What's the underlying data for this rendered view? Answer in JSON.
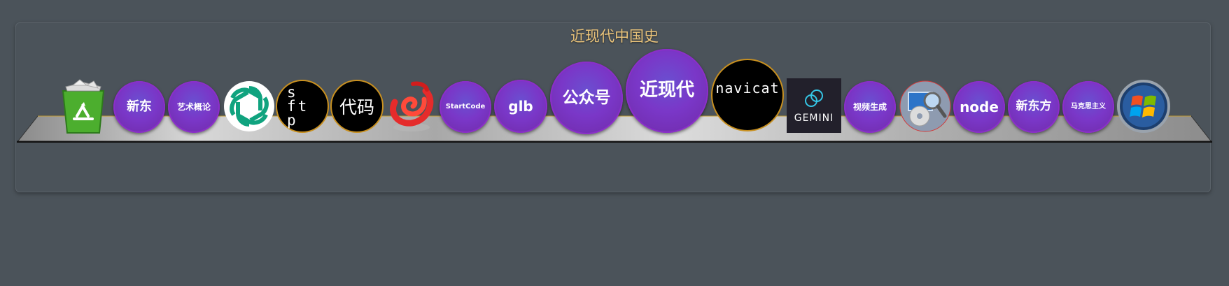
{
  "dock": {
    "title": "近现代中国史"
  },
  "items": {
    "recycle_bin": {
      "icon": "recycle-bin-icon"
    },
    "xindong": {
      "label": "新东"
    },
    "yishu": {
      "label": "艺术概论"
    },
    "chatgpt": {
      "icon": "chatgpt-logo-icon"
    },
    "sftp": {
      "chars": [
        "s",
        "ft",
        "p"
      ]
    },
    "daima": {
      "label": "代码"
    },
    "swirl": {
      "icon": "red-swirl-app-icon"
    },
    "startcode": {
      "label": "StartCode"
    },
    "glb": {
      "label": "glb"
    },
    "gongzhonghao": {
      "label": "公众号"
    },
    "jinxiandai": {
      "label": "近现代"
    },
    "navicat": {
      "label": "navicat"
    },
    "gemini": {
      "label": "GEMINI",
      "icon": "gemini-logo-icon"
    },
    "shipin": {
      "label": "视频生成"
    },
    "disk": {
      "icon": "disk-search-icon"
    },
    "node": {
      "label": "node"
    },
    "xindongfang": {
      "label": "新东方"
    },
    "makesi": {
      "label": "马克思主义"
    },
    "windows": {
      "icon": "windows-logo-icon"
    }
  },
  "colors": {
    "background": "#4b535a",
    "title": "#e8c27a",
    "bubble": "#7a37c8",
    "gemini_bg": "#22202b"
  }
}
